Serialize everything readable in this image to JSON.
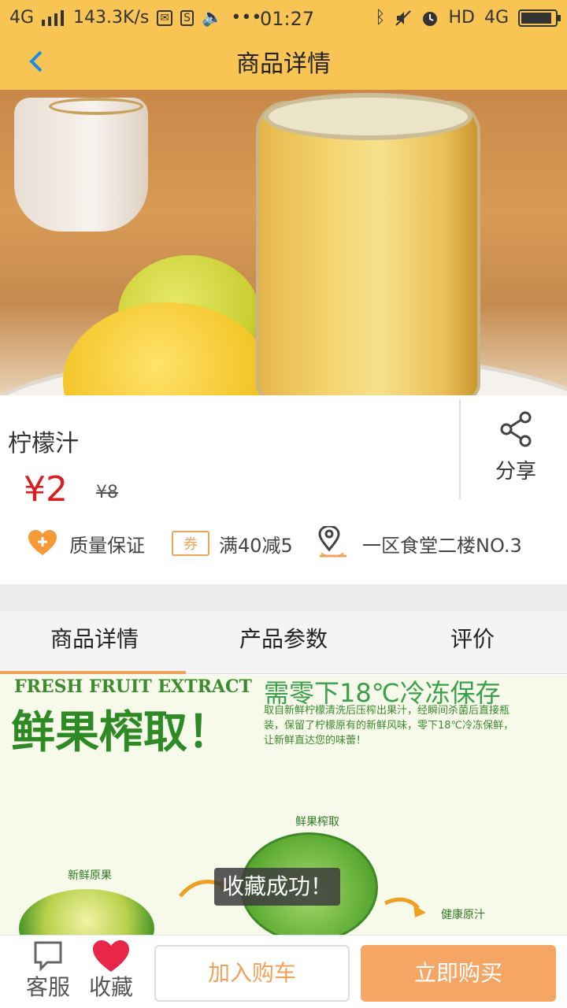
{
  "status_bar": {
    "network": "4G",
    "speed": "143.3K/s",
    "time": "01:27",
    "hd": "HD",
    "network_right": "4G"
  },
  "nav": {
    "title": "商品详情",
    "back_icon": "chevron-left-icon"
  },
  "product": {
    "name": "柠檬汁",
    "price": "¥2",
    "original_price": "¥8",
    "share_label": "分享",
    "tags": [
      {
        "label": "质量保证",
        "icon": "heart-plus-icon"
      },
      {
        "label": "满40减5",
        "icon_text": "券",
        "icon": "coupon-icon"
      },
      {
        "label": "一区食堂二楼NO.3",
        "icon": "location-pin-icon"
      }
    ]
  },
  "tabs": [
    {
      "label": "商品详情",
      "active": true
    },
    {
      "label": "产品参数",
      "active": false
    },
    {
      "label": "评价",
      "active": false
    }
  ],
  "detail_image": {
    "en_title": "FRESH FRUIT EXTRACT",
    "big_title": "鲜果榨取！",
    "heading": "需零下18℃冷冻保存",
    "paragraph": "取自新鲜柠檬清洗后压榨出果汁，经瞬间杀菌后直接瓶装，保留了柠檬原有的新鲜风味，零下18℃冷冻保鲜，让新鲜直达您的味蕾！",
    "label_extract": "鲜果榨取",
    "label_fresh": "新鲜原果",
    "label_juice": "健康原汁"
  },
  "toast": "收藏成功！",
  "bottom_bar": {
    "service_label": "客服",
    "favorite_label": "收藏",
    "add_cart_label": "加入购车",
    "buy_now_label": "立即购买"
  },
  "colors": {
    "header": "#f8c554",
    "price": "#d81e1e",
    "accent": "#f0a35a",
    "buy_button": "#f5a664",
    "back_icon": "#1a8ce8",
    "favorite": "#e8264a"
  }
}
